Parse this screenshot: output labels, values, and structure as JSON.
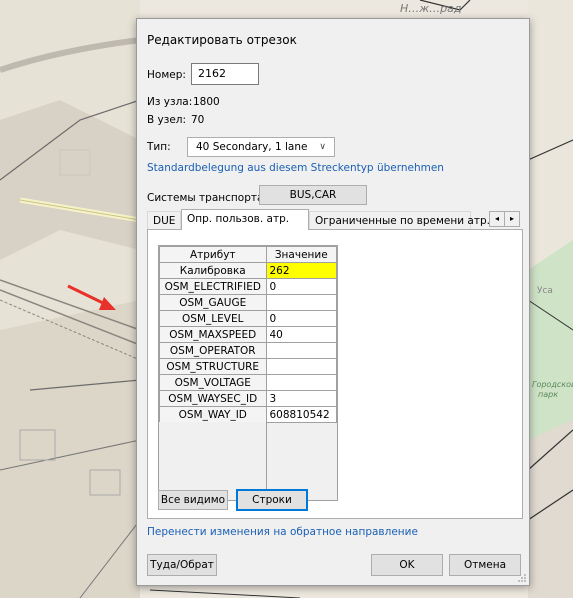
{
  "map": {
    "label_top": "Н…ж…рад",
    "label_right_1": "Уса",
    "label_right_2": "Городской",
    "label_right_3": "парк",
    "arrow_color": "#e8312a"
  },
  "dialog": {
    "title": "Редактировать отрезок",
    "number_label": "Номер:",
    "number_value": "2162",
    "from_node_label": "Из узла:",
    "from_node_value": "1800",
    "to_node_label": "В узел:",
    "to_node_value": "70",
    "type_label": "Тип:",
    "type_value": "40 Secondary, 1 lane",
    "std_link": "Standardbelegung aus diesem Streckentyp übernehmen",
    "tsys_label": "Системы транспорта:",
    "tsys_value": "BUS,CAR",
    "tabs": [
      {
        "label": "DUE"
      },
      {
        "label": "Опр. пользов. атр."
      },
      {
        "label": "Ограниченные по времени атр."
      }
    ],
    "grid": {
      "headers": [
        "Атрибут",
        "Значение"
      ],
      "rows": [
        {
          "name": "Калибровка",
          "value": "262"
        },
        {
          "name": "OSM_ELECTRIFIED",
          "value": "0"
        },
        {
          "name": "OSM_GAUGE",
          "value": ""
        },
        {
          "name": "OSM_LEVEL",
          "value": "0"
        },
        {
          "name": "OSM_MAXSPEED",
          "value": "40"
        },
        {
          "name": "OSM_OPERATOR",
          "value": ""
        },
        {
          "name": "OSM_STRUCTURE",
          "value": ""
        },
        {
          "name": "OSM_VOLTAGE",
          "value": ""
        },
        {
          "name": "OSM_WAYSEC_ID",
          "value": "3"
        },
        {
          "name": "OSM_WAY_ID",
          "value": "608810542"
        }
      ],
      "highlight_color": "#ffff00"
    },
    "all_visible_button": "Все видимо",
    "rows_button": "Строки",
    "transfer_link": "Перенести изменения на обратное направление",
    "reverse_button": "Туда/Обрат",
    "ok_button": "OK",
    "cancel_button": "Отмена",
    "scroll_left": "◂",
    "scroll_right": "▸",
    "combo_arrow": "∨"
  }
}
